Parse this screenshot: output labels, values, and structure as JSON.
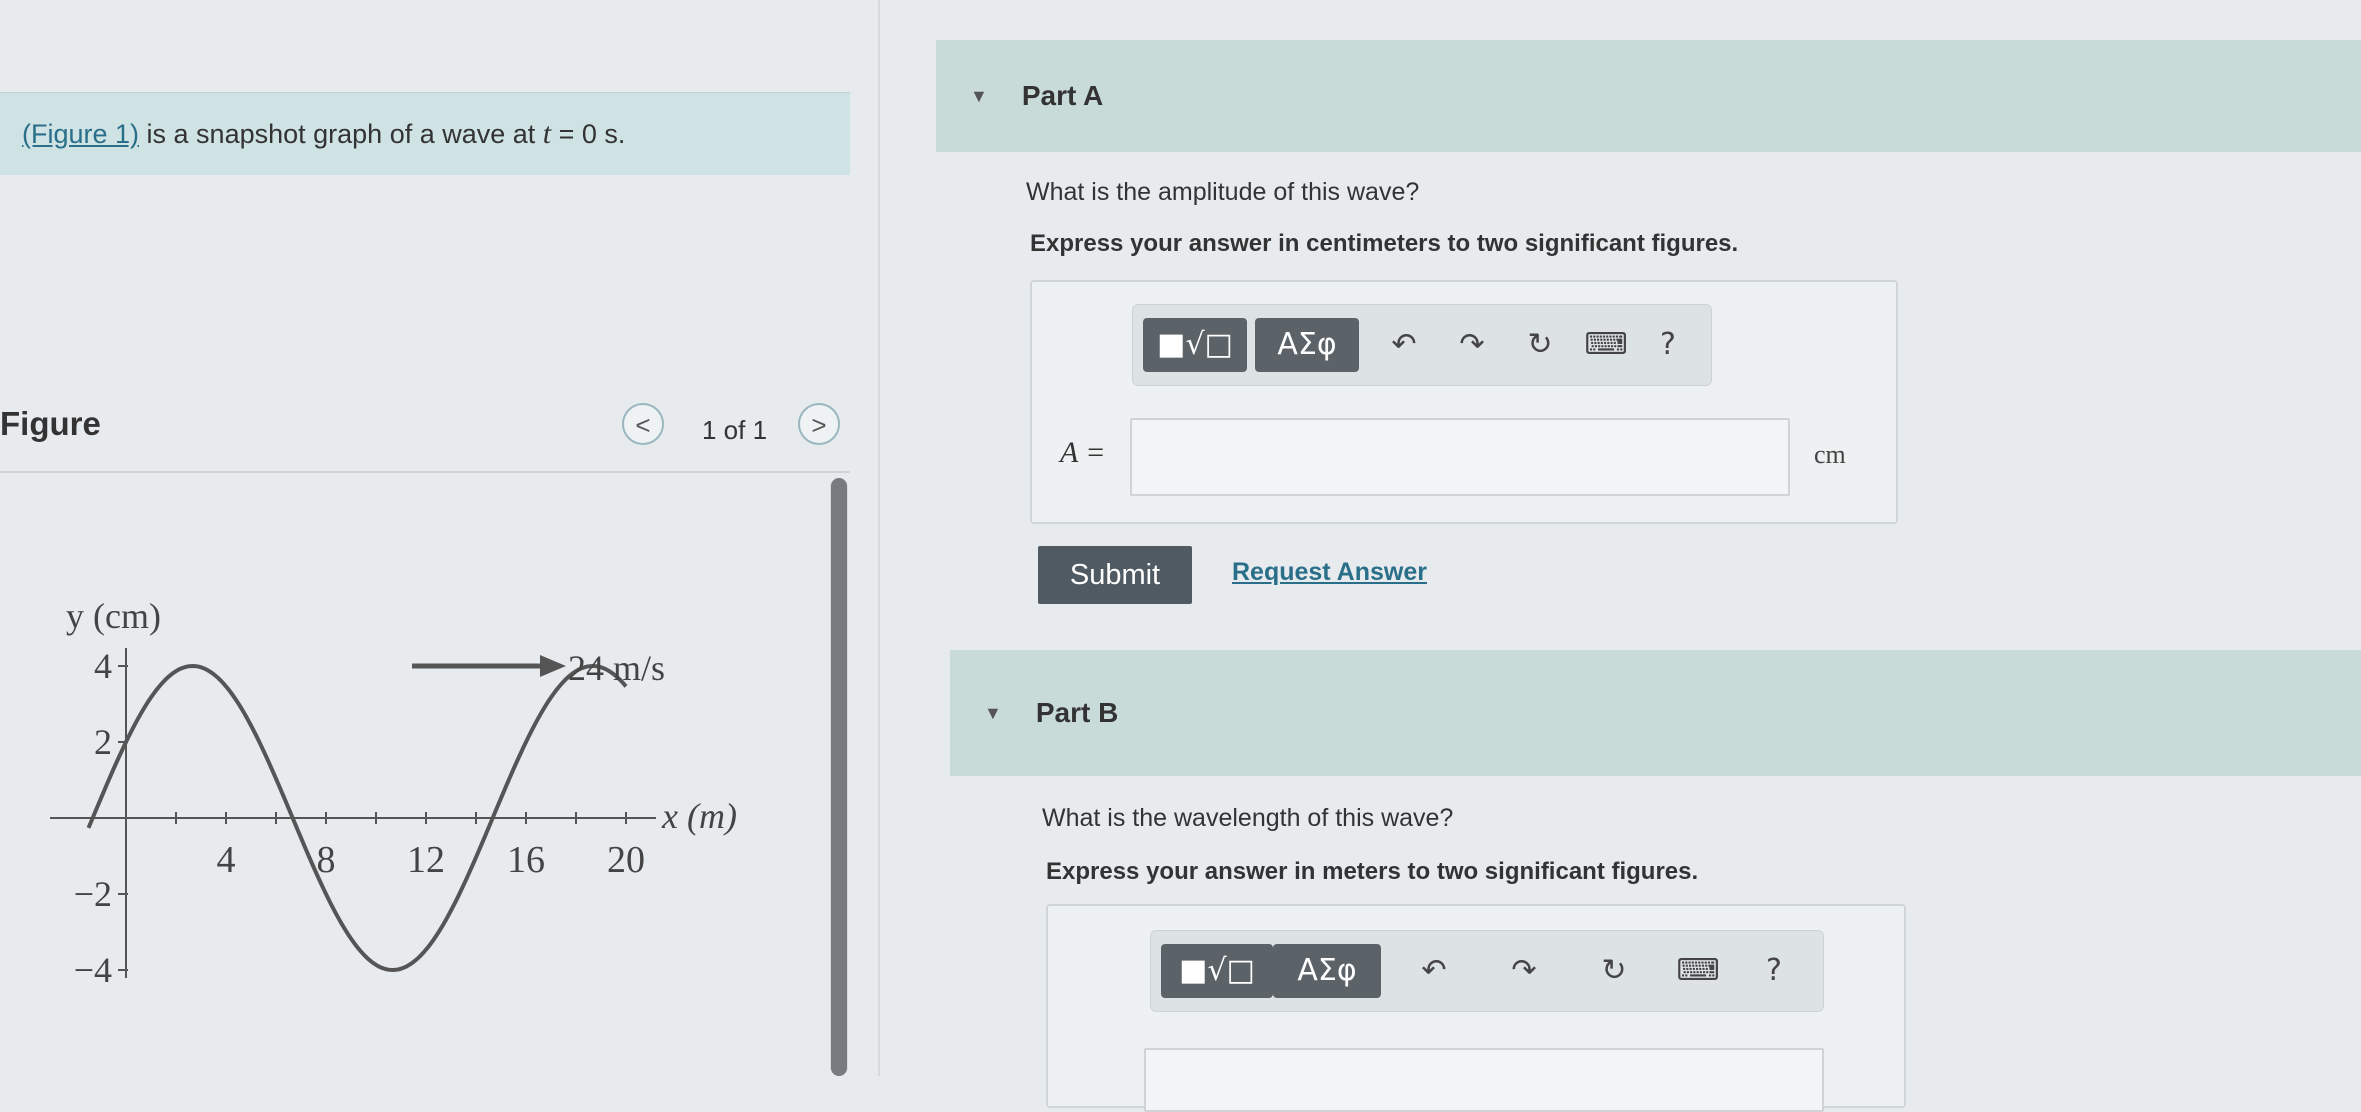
{
  "problem": {
    "figure_link": "(Figure 1)",
    "text_before_var": " is a snapshot graph of a wave at ",
    "var": "t",
    "text_after_var": " = 0 s."
  },
  "figure": {
    "title": "Figure",
    "pager": "1 of 1",
    "prev_label": "<",
    "next_label": ">"
  },
  "chart_data": {
    "type": "line",
    "ylabel": "y (cm)",
    "xlabel": "x (m)",
    "velocity_label": "24 m/s",
    "x_ticks": [
      "4",
      "8",
      "12",
      "16",
      "20"
    ],
    "y_ticks": [
      "4",
      "2",
      "−2",
      "−4"
    ],
    "amplitude": 4,
    "wavelength": 16,
    "phase_deg": 30,
    "x_range": [
      -1.5,
      20
    ],
    "ylim": [
      -4,
      4
    ]
  },
  "part_a": {
    "title": "Part A",
    "question": "What is the amplitude of this wave?",
    "instruction": "Express your answer in centimeters to two significant figures.",
    "answer_label": "A =",
    "unit": "cm",
    "submit": "Submit",
    "request": "Request Answer"
  },
  "part_b": {
    "title": "Part B",
    "question": "What is the wavelength of this wave?",
    "instruction": "Express your answer in meters to two significant figures."
  },
  "toolbar": {
    "templates_label": "■√□",
    "symbols_label": "ΑΣφ",
    "help_label": "?"
  }
}
